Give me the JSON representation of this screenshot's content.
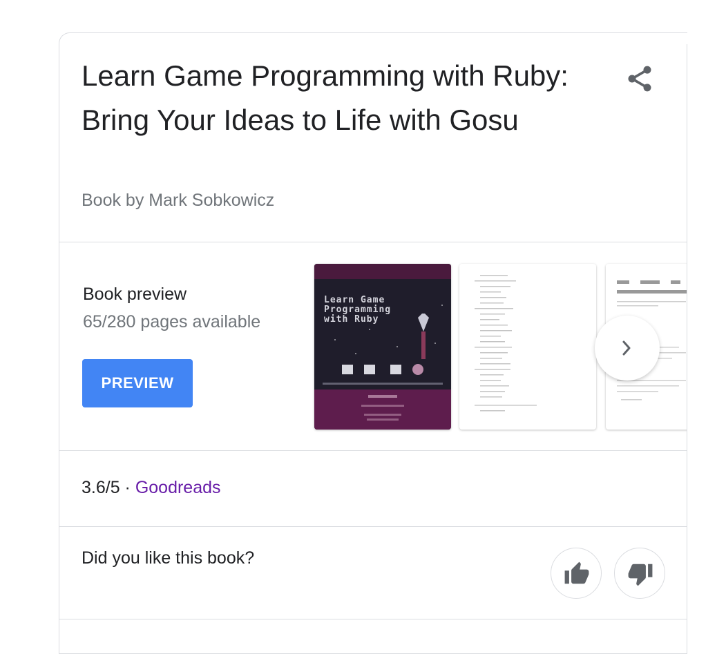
{
  "book": {
    "title": "Learn Game Programming with Ruby: Bring Your Ideas to Life with Gosu",
    "subtitle": "Book by Mark Sobkowicz"
  },
  "preview": {
    "label": "Book preview",
    "pages_available": "65/280 pages available",
    "button_label": "PREVIEW",
    "cover_text": "Learn Game\nProgramming\nwith Ruby"
  },
  "rating": {
    "score": "3.6/5",
    "separator": " · ",
    "source": "Goodreads"
  },
  "feedback": {
    "question": "Did you like this book?"
  },
  "icons": {
    "share": "share-icon",
    "next": "chevron-right-icon",
    "like": "thumbs-up-icon",
    "dislike": "thumbs-down-icon"
  },
  "colors": {
    "accent": "#4285f4",
    "link": "#681da8",
    "text": "#202124",
    "secondary": "#70757a"
  }
}
